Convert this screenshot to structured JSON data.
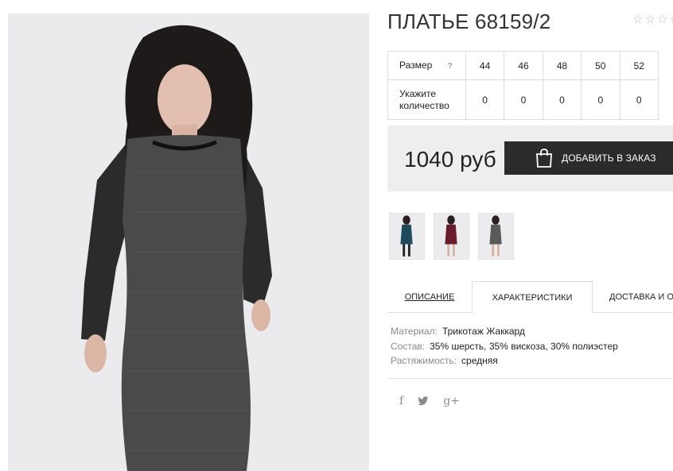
{
  "product": {
    "title": "ПЛАТЬЕ 68159/2",
    "rating": {
      "value": 0,
      "max": 5
    },
    "main_image": {
      "alt": "Dress with lace sleeves on model"
    }
  },
  "size_table": {
    "size_label": "Размер",
    "help_icon": "?",
    "quantity_label": "Укажите количество",
    "sizes": [
      "44",
      "46",
      "48",
      "50",
      "52"
    ],
    "quantities": [
      "0",
      "0",
      "0",
      "0",
      "0"
    ]
  },
  "purchase": {
    "price": "1040 руб",
    "add_button_label": "ДОБАВИТЬ В ЗАКАЗ",
    "button_icon": "shopping-bag-icon"
  },
  "thumbnails": [
    {
      "color_name": "teal",
      "dress_color": "#1d4b5c"
    },
    {
      "color_name": "burgundy",
      "dress_color": "#6a1c2c"
    },
    {
      "color_name": "grey",
      "dress_color": "#5a5a5a"
    }
  ],
  "tabs": [
    {
      "label": "ОПИСАНИЕ",
      "active": false
    },
    {
      "label": "ХАРАКТЕРИСТИКИ",
      "active": true
    },
    {
      "label": "ДОСТАВКА И ОПЛАТА",
      "active": false
    }
  ],
  "characteristics": [
    {
      "key": "Материал:",
      "value": "Трикотаж Жаккард"
    },
    {
      "key": "Состав:",
      "value": "35% шерсть, 35% вискоза, 30% полиэстер"
    },
    {
      "key": "Растяжимость:",
      "value": "средняя"
    }
  ],
  "social": [
    {
      "name": "facebook-icon",
      "glyph": "f"
    },
    {
      "name": "twitter-icon",
      "glyph": "🐦"
    },
    {
      "name": "google-plus-icon",
      "glyph": "g+"
    }
  ],
  "colors": {
    "button_bg": "#2b2b2b",
    "price_box_bg": "#eeeeee",
    "border": "#dcdcdc"
  }
}
